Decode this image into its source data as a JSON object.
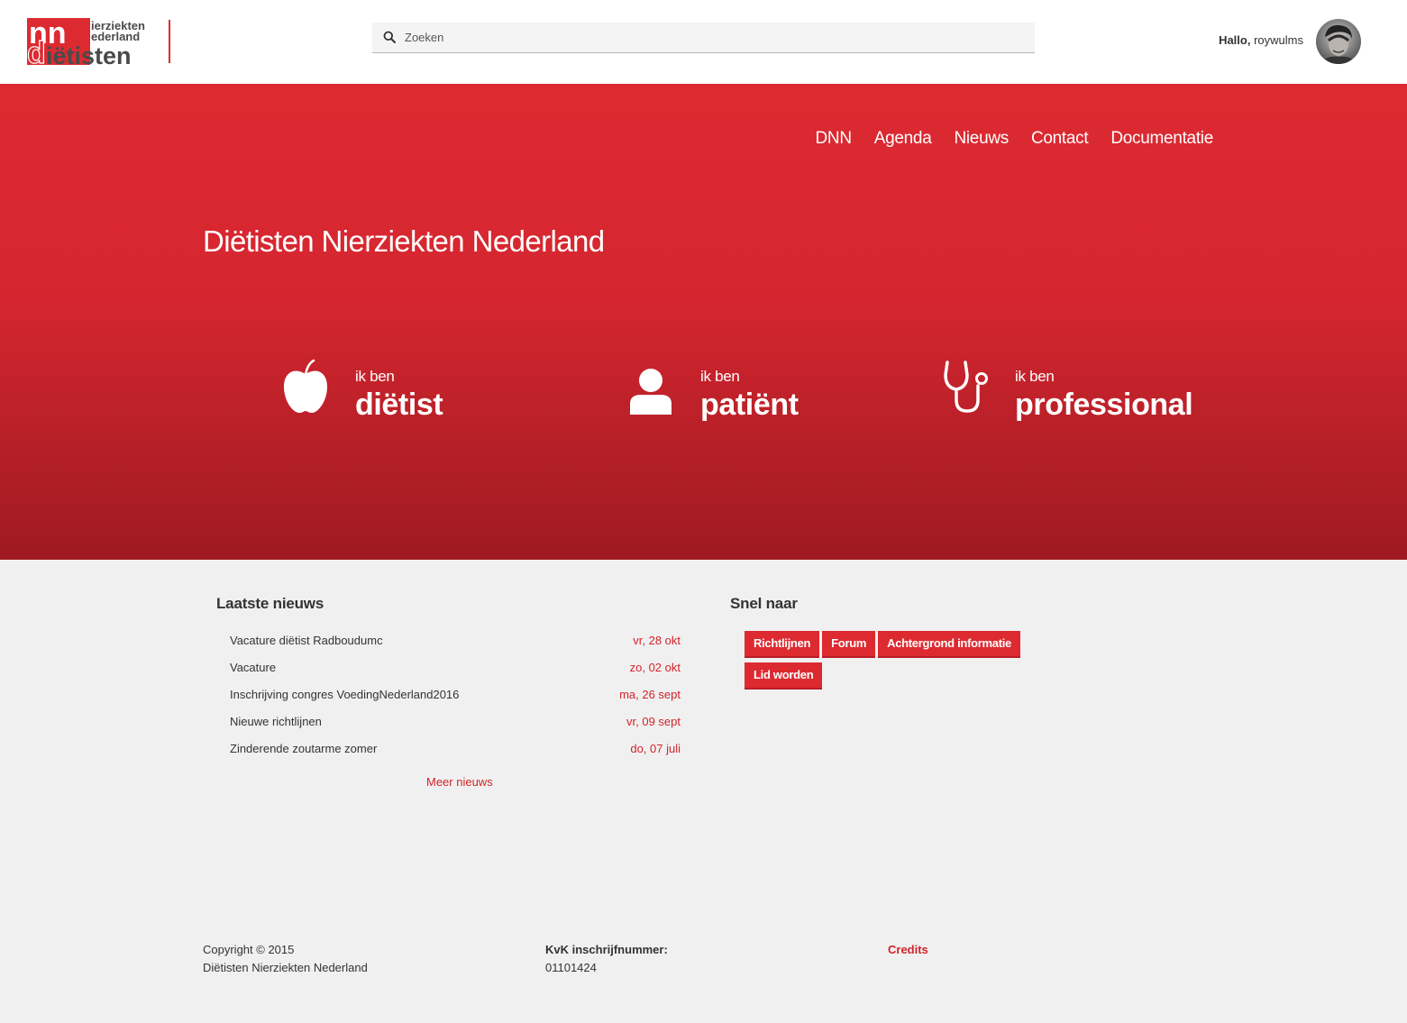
{
  "header": {
    "logo": {
      "letters": "dnn",
      "line1": "ierziekten",
      "line2": "ederland",
      "line3": "iëtisten"
    },
    "search": {
      "placeholder": "Zoeken"
    },
    "user": {
      "greeting": "Hallo,",
      "username": "roywulms"
    }
  },
  "nav": {
    "items": [
      "DNN",
      "Agenda",
      "Nieuws",
      "Contact",
      "Documentatie"
    ]
  },
  "hero": {
    "title": "Diëtisten Nierziekten Nederland",
    "roles": [
      {
        "small": "ik ben",
        "big": "diëtist",
        "icon": "apple-icon"
      },
      {
        "small": "ik ben",
        "big": "patiënt",
        "icon": "user-icon"
      },
      {
        "small": "ik ben",
        "big": "professional",
        "icon": "stethoscope-icon"
      }
    ]
  },
  "news": {
    "title": "Laatste nieuws",
    "items": [
      {
        "title": "Vacature diëtist Radboudumc",
        "date": "vr, 28 okt"
      },
      {
        "title": "Vacature",
        "date": "zo, 02 okt"
      },
      {
        "title": "Inschrijving congres VoedingNederland2016",
        "date": "ma, 26 sept"
      },
      {
        "title": "Nieuwe richtlijnen",
        "date": "vr, 09 sept"
      },
      {
        "title": "Zinderende zoutarme zomer",
        "date": "do, 07 juli"
      }
    ],
    "more": "Meer nieuws"
  },
  "quicklinks": {
    "title": "Snel naar",
    "items": [
      "Richtlijnen",
      "Forum",
      "Achtergrond informatie",
      "Lid worden"
    ]
  },
  "footer": {
    "copyright_line1": "Copyright © 2015",
    "copyright_line2": "Diëtisten Nierziekten Nederland",
    "kvk_label": "KvK inschrijfnummer:",
    "kvk_number": "01101424",
    "credits": "Credits"
  },
  "colors": {
    "brand_red": "#dd2a31",
    "dark_red": "#9e1a20",
    "logo_gray": "#4a4a4a"
  }
}
